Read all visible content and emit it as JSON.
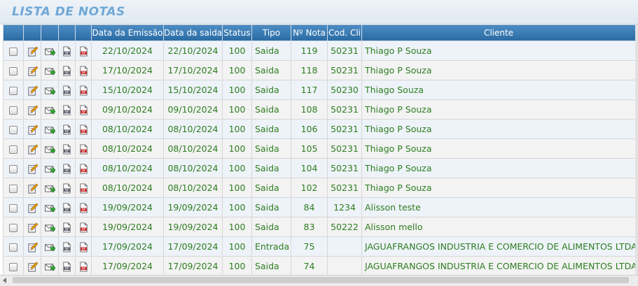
{
  "page": {
    "title": "LISTA DE NOTAS"
  },
  "table": {
    "columns": [
      "",
      "",
      "",
      "",
      "",
      "Data da Emissão",
      "Data da saida",
      "Status",
      "Tipo",
      "Nº Nota",
      "Cod. Cli",
      "Cliente"
    ],
    "row_icons": [
      "checkbox",
      "edit-icon",
      "send-email-icon",
      "nfe-document-icon",
      "nfe-pdf-icon"
    ],
    "rows": [
      {
        "emissao": "22/10/2024",
        "saida": "22/10/2024",
        "status": "100",
        "tipo": "Saida",
        "nota": "119",
        "cod_cli": "50231",
        "cliente": "Thiago P Souza"
      },
      {
        "emissao": "17/10/2024",
        "saida": "17/10/2024",
        "status": "100",
        "tipo": "Saida",
        "nota": "118",
        "cod_cli": "50231",
        "cliente": "Thiago P Souza"
      },
      {
        "emissao": "15/10/2024",
        "saida": "15/10/2024",
        "status": "100",
        "tipo": "Saida",
        "nota": "117",
        "cod_cli": "50230",
        "cliente": "Thiago Souza"
      },
      {
        "emissao": "09/10/2024",
        "saida": "09/10/2024",
        "status": "100",
        "tipo": "Saida",
        "nota": "108",
        "cod_cli": "50231",
        "cliente": "Thiago P Souza"
      },
      {
        "emissao": "08/10/2024",
        "saida": "08/10/2024",
        "status": "100",
        "tipo": "Saida",
        "nota": "106",
        "cod_cli": "50231",
        "cliente": "Thiago P Souza"
      },
      {
        "emissao": "08/10/2024",
        "saida": "08/10/2024",
        "status": "100",
        "tipo": "Saida",
        "nota": "105",
        "cod_cli": "50231",
        "cliente": "Thiago P Souza"
      },
      {
        "emissao": "08/10/2024",
        "saida": "08/10/2024",
        "status": "100",
        "tipo": "Saida",
        "nota": "104",
        "cod_cli": "50231",
        "cliente": "Thiago P Souza"
      },
      {
        "emissao": "08/10/2024",
        "saida": "08/10/2024",
        "status": "100",
        "tipo": "Saida",
        "nota": "102",
        "cod_cli": "50231",
        "cliente": "Thiago P Souza"
      },
      {
        "emissao": "19/09/2024",
        "saida": "19/09/2024",
        "status": "100",
        "tipo": "Saida",
        "nota": "84",
        "cod_cli": "1234",
        "cliente": "Alisson teste"
      },
      {
        "emissao": "19/09/2024",
        "saida": "19/09/2024",
        "status": "100",
        "tipo": "Saida",
        "nota": "83",
        "cod_cli": "50222",
        "cliente": "Alisson mello"
      },
      {
        "emissao": "17/09/2024",
        "saida": "17/09/2024",
        "status": "100",
        "tipo": "Entrada",
        "nota": "75",
        "cod_cli": "",
        "cliente": "JAGUAFRANGOS INDUSTRIA E COMERCIO DE ALIMENTOS LTDA"
      },
      {
        "emissao": "17/09/2024",
        "saida": "17/09/2024",
        "status": "100",
        "tipo": "Saida",
        "nota": "74",
        "cod_cli": "",
        "cliente": "JAGUAFRANGOS INDUSTRIA E COMERCIO DE ALIMENTOS LTDA"
      }
    ]
  },
  "colors": {
    "header_bg": "#2e6da4",
    "title": "#6fa8d8",
    "cell_text": "#2e7d20",
    "row_odd": "#eef3f9",
    "row_even": "#f3f3f3"
  }
}
